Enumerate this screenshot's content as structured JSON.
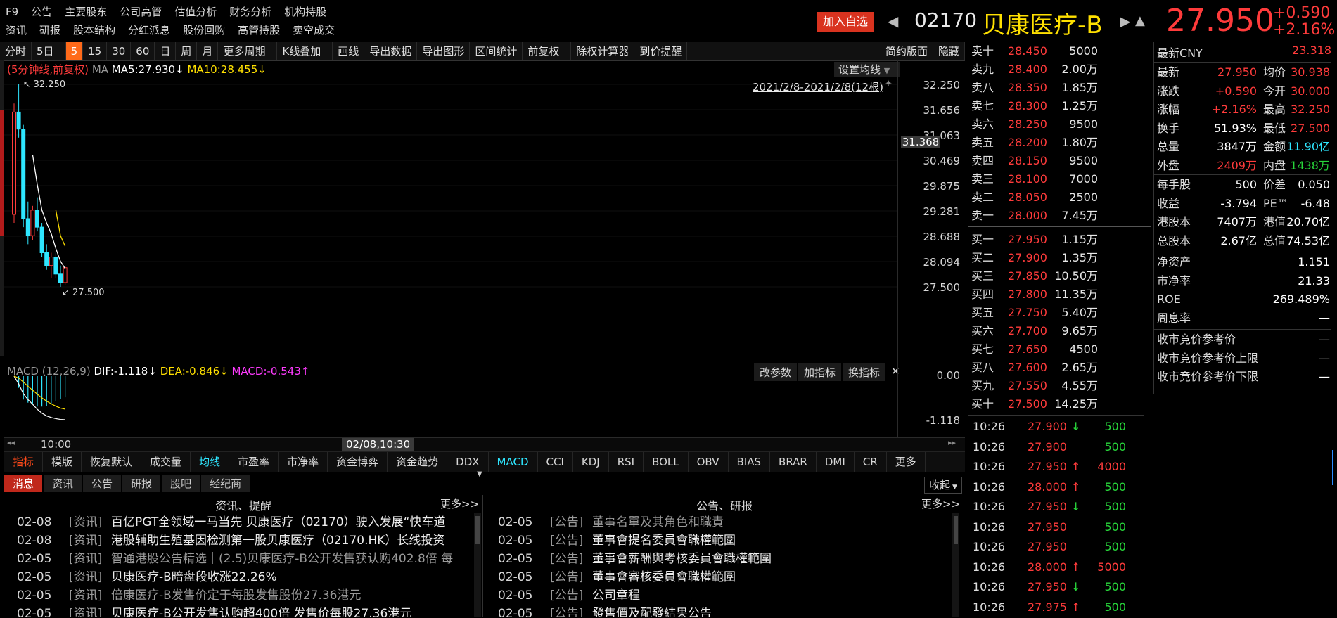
{
  "menu": {
    "row1": [
      "F9",
      "公告",
      "主要股东",
      "公司高管",
      "估值分析",
      "财务分析",
      "机构持股"
    ],
    "row2": [
      "资讯",
      "研报",
      "股本结构",
      "分红派息",
      "股份回购",
      "高管持股",
      "卖空成交"
    ]
  },
  "header": {
    "add_watch": "加入自选",
    "code": "02170",
    "name": "贝康医疗-B",
    "price": "27.950",
    "change": "+0.590",
    "change_pct": "+2.16%"
  },
  "toolbar": {
    "items": [
      "分时",
      "5日",
      "5",
      "15",
      "30",
      "60",
      "日",
      "周",
      "月",
      "更多周期",
      "K线叠加",
      "画线",
      "导出数据",
      "导出图形",
      "区间统计",
      "前复权",
      "除权计算器",
      "到价提醒"
    ],
    "right": [
      "简约版面",
      "隐藏"
    ]
  },
  "chart_legend": {
    "period": "(5分钟线,前复权)",
    "ma": "MA",
    "ma5": "MA5:27.930↓",
    "ma10": "MA10:28.455↓",
    "settings": "设置均线",
    "range": "2021/2/8-2021/2/8(12根)"
  },
  "chart_data": {
    "type": "candlestick",
    "y_ticks": [
      "32.250",
      "31.656",
      "31.063",
      "30.469",
      "29.875",
      "29.281",
      "28.688",
      "28.094",
      "27.500"
    ],
    "cursor_price": "31.368",
    "high_label": "32.250",
    "low_label": "27.500",
    "x_label": "10:00",
    "x_cursor_label": "02/08,10:30",
    "candles": [
      {
        "o": 29.2,
        "h": 31.8,
        "l": 29.0,
        "c": 31.6
      },
      {
        "o": 31.6,
        "h": 32.25,
        "l": 31.0,
        "c": 31.2
      },
      {
        "o": 31.2,
        "h": 31.3,
        "l": 28.9,
        "c": 29.1
      },
      {
        "o": 29.1,
        "h": 29.5,
        "l": 28.5,
        "c": 28.7
      },
      {
        "o": 28.7,
        "h": 29.4,
        "l": 28.6,
        "c": 29.3
      },
      {
        "o": 29.3,
        "h": 29.6,
        "l": 28.8,
        "c": 28.9
      },
      {
        "o": 28.9,
        "h": 29.0,
        "l": 28.2,
        "c": 28.3
      },
      {
        "o": 28.3,
        "h": 28.5,
        "l": 27.9,
        "c": 28.0
      },
      {
        "o": 28.0,
        "h": 28.3,
        "l": 27.7,
        "c": 28.2
      },
      {
        "o": 28.2,
        "h": 28.3,
        "l": 27.7,
        "c": 27.8
      },
      {
        "o": 27.8,
        "h": 28.0,
        "l": 27.5,
        "c": 27.6
      },
      {
        "o": 27.6,
        "h": 28.0,
        "l": 27.55,
        "c": 27.95
      }
    ],
    "ma5": [
      null,
      null,
      null,
      null,
      30.6,
      29.9,
      29.3,
      29.0,
      28.75,
      28.4,
      28.1,
      27.93
    ],
    "ma10": [
      null,
      null,
      null,
      null,
      null,
      null,
      null,
      null,
      null,
      29.3,
      28.7,
      28.455
    ]
  },
  "macd": {
    "title": "MACD (12,26,9)",
    "dif": "DIF:-1.118↓",
    "dea": "DEA:-0.846↓",
    "macd": "MACD:-0.543↑",
    "buttons": [
      "改参数",
      "加指标",
      "换指标"
    ],
    "top": "0.00",
    "bottom": "-1.118",
    "dif_values": [
      0,
      -0.2,
      -0.45,
      -0.6,
      -0.72,
      -0.85,
      -0.95,
      -1.02,
      -1.06,
      -1.09,
      -1.11,
      -1.118
    ],
    "dea_values": [
      0,
      -0.05,
      -0.15,
      -0.26,
      -0.36,
      -0.46,
      -0.56,
      -0.64,
      -0.71,
      -0.77,
      -0.82,
      -0.846
    ],
    "bars": [
      0,
      -0.3,
      -0.6,
      -0.68,
      -0.72,
      -0.78,
      -0.78,
      -0.76,
      -0.7,
      -0.64,
      -0.58,
      -0.543
    ]
  },
  "indicator_tabs": [
    "指标",
    "模版",
    "恢复默认",
    "成交量",
    "均线",
    "市盈率",
    "市净率",
    "资金博弈",
    "资金趋势",
    "DDX",
    "MACD",
    "CCI",
    "KDJ",
    "RSI",
    "BOLL",
    "OBV",
    "BIAS",
    "BRAR",
    "DMI",
    "CR",
    "更多"
  ],
  "news_tabs": [
    "消息",
    "资讯",
    "公告",
    "研报",
    "股吧",
    "经纪商"
  ],
  "news_collapse": "收起",
  "news_left": {
    "title": "资讯、提醒",
    "more": "更多>>",
    "items": [
      {
        "date": "02-08",
        "cat": "[资讯]",
        "title": "百亿PGT全领域一马当先 贝康医疗（02170）驶入发展“快车道"
      },
      {
        "date": "02-08",
        "cat": "[资讯]",
        "title": "港股辅助生殖基因检测第一股贝康医疗（02170.HK）长线投资"
      },
      {
        "date": "02-05",
        "cat": "[资讯]",
        "title": "智通港股公告精选｜(2.5)贝康医疗-B公开发售获认购402.8倍 每"
      },
      {
        "date": "02-05",
        "cat": "[资讯]",
        "title": "贝康医疗-B暗盘段收涨22.26%"
      },
      {
        "date": "02-05",
        "cat": "[资讯]",
        "title": "倍康医疗-B发售价定于每股发售股份27.36港元"
      },
      {
        "date": "02-05",
        "cat": "[资讯]",
        "title": "贝康医疗-B公开发售认购超400倍 发售价每股27.36港元"
      }
    ]
  },
  "news_right": {
    "title": "公告、研报",
    "more": "更多>>",
    "items": [
      {
        "date": "02-05",
        "cat": "[公告]",
        "title": "董事名單及其角色和職責"
      },
      {
        "date": "02-05",
        "cat": "[公告]",
        "title": "董事會提名委員會職權範圍"
      },
      {
        "date": "02-05",
        "cat": "[公告]",
        "title": "董事會薪酬與考核委員會職權範圍"
      },
      {
        "date": "02-05",
        "cat": "[公告]",
        "title": "董事會審核委員會職權範圍"
      },
      {
        "date": "02-05",
        "cat": "[公告]",
        "title": "公司章程"
      },
      {
        "date": "02-05",
        "cat": "[公告]",
        "title": "發售價及配發結果公告"
      }
    ]
  },
  "order_book": {
    "asks": [
      {
        "label": "卖十",
        "price": "28.450",
        "vol": "5000"
      },
      {
        "label": "卖九",
        "price": "28.400",
        "vol": "2.00万"
      },
      {
        "label": "卖八",
        "price": "28.350",
        "vol": "1.85万"
      },
      {
        "label": "卖七",
        "price": "28.300",
        "vol": "1.25万"
      },
      {
        "label": "卖六",
        "price": "28.250",
        "vol": "9500"
      },
      {
        "label": "卖五",
        "price": "28.200",
        "vol": "1.80万"
      },
      {
        "label": "卖四",
        "price": "28.150",
        "vol": "9500"
      },
      {
        "label": "卖三",
        "price": "28.100",
        "vol": "7000"
      },
      {
        "label": "卖二",
        "price": "28.050",
        "vol": "2500"
      },
      {
        "label": "卖一",
        "price": "28.000",
        "vol": "7.45万"
      }
    ],
    "bids": [
      {
        "label": "买一",
        "price": "27.950",
        "vol": "1.15万"
      },
      {
        "label": "买二",
        "price": "27.900",
        "vol": "1.35万"
      },
      {
        "label": "买三",
        "price": "27.850",
        "vol": "10.50万"
      },
      {
        "label": "买四",
        "price": "27.800",
        "vol": "11.35万"
      },
      {
        "label": "买五",
        "price": "27.750",
        "vol": "5.40万"
      },
      {
        "label": "买六",
        "price": "27.700",
        "vol": "9.65万"
      },
      {
        "label": "买七",
        "price": "27.650",
        "vol": "4500"
      },
      {
        "label": "买八",
        "price": "27.600",
        "vol": "2.65万"
      },
      {
        "label": "买九",
        "price": "27.550",
        "vol": "4.55万"
      },
      {
        "label": "买十",
        "price": "27.500",
        "vol": "14.25万"
      }
    ]
  },
  "ticks": [
    {
      "time": "10:26",
      "price": "27.900",
      "arrow": "↓",
      "vol": "500"
    },
    {
      "time": "10:26",
      "price": "27.900",
      "arrow": "",
      "vol": "500"
    },
    {
      "time": "10:26",
      "price": "27.950",
      "arrow": "↑",
      "vol": "4000"
    },
    {
      "time": "10:26",
      "price": "28.000",
      "arrow": "↑",
      "vol": "500"
    },
    {
      "time": "10:26",
      "price": "27.950",
      "arrow": "↓",
      "vol": "500"
    },
    {
      "time": "10:26",
      "price": "27.950",
      "arrow": "",
      "vol": "500"
    },
    {
      "time": "10:26",
      "price": "27.950",
      "arrow": "",
      "vol": "500"
    },
    {
      "time": "10:26",
      "price": "28.000",
      "arrow": "↑",
      "vol": "5000"
    },
    {
      "time": "10:26",
      "price": "27.950",
      "arrow": "↓",
      "vol": "500"
    },
    {
      "time": "10:26",
      "price": "27.975",
      "arrow": "↑",
      "vol": "500"
    }
  ],
  "quote": {
    "latest_cny_label": "最新CNY",
    "latest_cny": "23.318",
    "rows1": [
      {
        "k1": "最新",
        "v1": "27.950",
        "c1": "red",
        "k2": "均价",
        "v2": "30.938",
        "c2": "red"
      },
      {
        "k1": "涨跌",
        "v1": "+0.590",
        "c1": "red",
        "k2": "今开",
        "v2": "30.000",
        "c2": "red"
      },
      {
        "k1": "涨幅",
        "v1": "+2.16%",
        "c1": "red",
        "k2": "最高",
        "v2": "32.250",
        "c2": "red"
      },
      {
        "k1": "换手",
        "v1": "51.93%",
        "c1": "white",
        "k2": "最低",
        "v2": "27.500",
        "c2": "red"
      },
      {
        "k1": "总量",
        "v1": "3847万",
        "c1": "white",
        "k2": "金额",
        "v2": "11.90亿",
        "c2": "cyan"
      },
      {
        "k1": "外盘",
        "v1": "2409万",
        "c1": "red",
        "k2": "内盘",
        "v2": "1438万",
        "c2": "green"
      }
    ],
    "rows2": [
      {
        "k1": "每手股",
        "v1": "500",
        "c1": "white",
        "k2": "价差",
        "v2": "0.050",
        "c2": "white"
      },
      {
        "k1": "收益",
        "v1": "-3.794",
        "c1": "white",
        "k2": "PE™",
        "v2": "-6.48",
        "c2": "white"
      },
      {
        "k1": "港股本",
        "v1": "7407万",
        "c1": "white",
        "k2": "港值",
        "v2": "20.70亿",
        "c2": "white"
      },
      {
        "k1": "总股本",
        "v1": "2.67亿",
        "c1": "white",
        "k2": "总值",
        "v2": "74.53亿",
        "c2": "white"
      }
    ],
    "rows3": [
      {
        "k": "净资产",
        "v": "1.151"
      },
      {
        "k": "市净率",
        "v": "21.33"
      },
      {
        "k": "ROE",
        "v": "269.489%"
      },
      {
        "k": "周息率",
        "v": "—"
      }
    ],
    "rows4": [
      {
        "k": "收市竞价参考价",
        "v": "—"
      },
      {
        "k": "收市竞价参考价上限",
        "v": "—"
      },
      {
        "k": "收市竞价参考价下限",
        "v": "—"
      }
    ]
  }
}
